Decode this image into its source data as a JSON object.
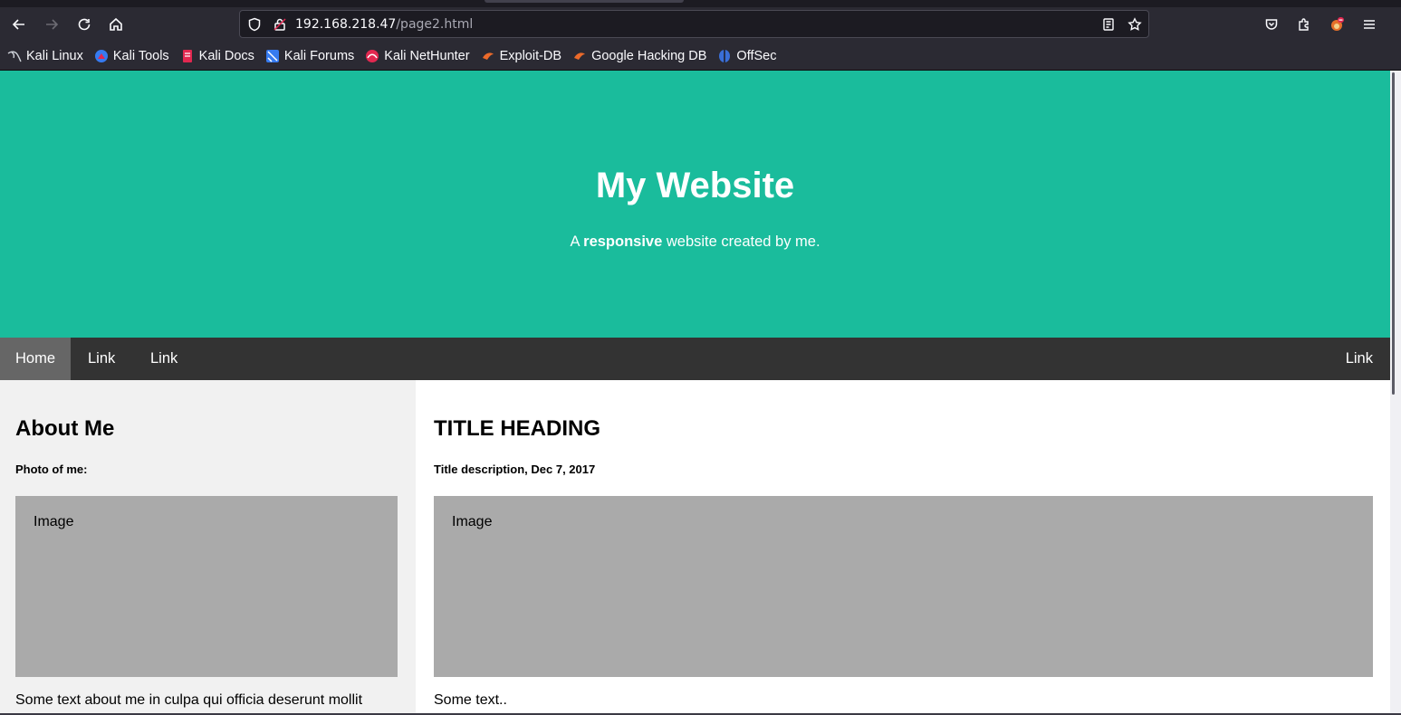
{
  "browser": {
    "url_host": "192.168.218.47",
    "url_path": "/page2.html",
    "bookmarks": [
      {
        "label": "Kali Linux",
        "icon": "kali-dragon-icon"
      },
      {
        "label": "Kali Tools",
        "icon": "kali-tools-icon"
      },
      {
        "label": "Kali Docs",
        "icon": "kali-docs-icon"
      },
      {
        "label": "Kali Forums",
        "icon": "kali-forums-icon"
      },
      {
        "label": "Kali NetHunter",
        "icon": "kali-nethunter-icon"
      },
      {
        "label": "Exploit-DB",
        "icon": "exploit-db-icon"
      },
      {
        "label": "Google Hacking DB",
        "icon": "ghdb-icon"
      },
      {
        "label": "OffSec",
        "icon": "offsec-icon"
      }
    ]
  },
  "header": {
    "title": "My Website",
    "tagline_prefix": "A ",
    "tagline_bold": "responsive",
    "tagline_suffix": " website created by me."
  },
  "nav": {
    "home": "Home",
    "link1": "Link",
    "link2": "Link",
    "link_right": "Link"
  },
  "side": {
    "heading": "About Me",
    "subheading": "Photo of me:",
    "image_label": "Image",
    "text": "Some text about me in culpa qui officia deserunt mollit"
  },
  "main": {
    "heading": "TITLE HEADING",
    "subheading": "Title description, Dec 7, 2017",
    "image_label": "Image",
    "text": "Some text.."
  },
  "colors": {
    "header_bg": "#1abc9c",
    "nav_bg": "#333333",
    "nav_active_bg": "#666666",
    "side_bg": "#f1f1f1",
    "fakeimg_bg": "#aaaaaa"
  }
}
